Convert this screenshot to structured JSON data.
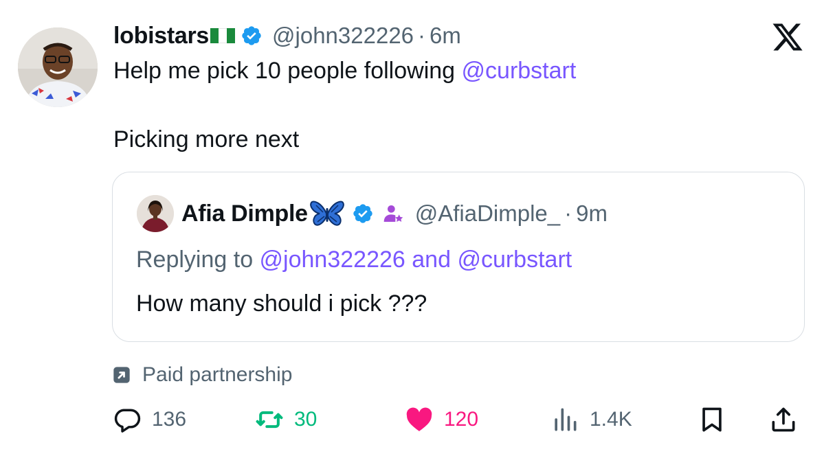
{
  "author": {
    "name": "lobistars",
    "handle": "@john322226",
    "separator": "·",
    "time": "6m"
  },
  "tweet": {
    "line1_prefix": "Help me pick 10 people following ",
    "line1_mention": "@curbstart",
    "line2": "Picking more next"
  },
  "quoted": {
    "name": "Afia Dimple",
    "handle": "@AfiaDimple_",
    "separator": "·",
    "time": "9m",
    "replying_prefix": "Replying to ",
    "replying_mention1": "@john322226",
    "replying_and": " and ",
    "replying_mention2": "@curbstart",
    "text": "How many should i pick ???"
  },
  "paid_partnership": "Paid partnership",
  "actions": {
    "replies": "136",
    "reposts": "30",
    "likes": "120",
    "views": "1.4K"
  },
  "colors": {
    "mention": "#7856ff",
    "verified": "#1d9bf0",
    "repost_active": "#00ba7c",
    "like_active": "#f91880",
    "secondary_text": "#536471"
  }
}
